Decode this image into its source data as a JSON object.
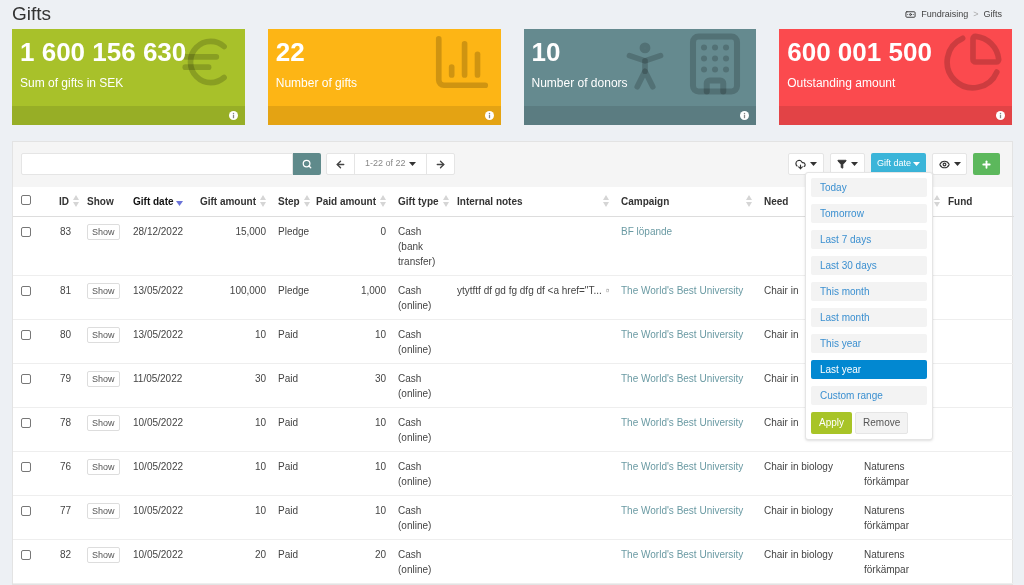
{
  "page_title": "Gifts",
  "breadcrumb": [
    "Fundraising",
    ">",
    "Gifts"
  ],
  "cards": [
    {
      "value": "1 600 156 630",
      "label": "Sum of gifts in SEK",
      "color": "#a8c12a"
    },
    {
      "value": "22",
      "label": "Number of gifts",
      "color": "#fdb515"
    },
    {
      "value": "10",
      "label": "Number of donors",
      "color": "#658a8f"
    },
    {
      "value": "600 001 500",
      "label": "Outstanding amount",
      "color": "#fb4a4e"
    }
  ],
  "toolbar": {
    "pagination": "1-22 of 22",
    "date_filter": "Gift date"
  },
  "table": {
    "select_all_checked": false,
    "columns": [
      {
        "label": "ID",
        "sorted": false
      },
      {
        "label": "Show",
        "sorted": false
      },
      {
        "label": "Gift date",
        "sorted": true
      },
      {
        "label": "Gift amount",
        "sorted": false
      },
      {
        "label": "Step",
        "sorted": false
      },
      {
        "label": "Paid amount",
        "sorted": false
      },
      {
        "label": "Gift type",
        "sorted": false
      },
      {
        "label": "Internal notes",
        "sorted": false
      },
      {
        "label": "Campaign",
        "sorted": false
      },
      {
        "label": "Need",
        "sorted": false
      },
      {
        "sorted": false
      },
      {
        "label": "Fund",
        "sorted": false
      }
    ],
    "rows": [
      {
        "checked": false,
        "id": "83",
        "show": "Show",
        "gift_date": "28/12/2022",
        "gift_amount": "15,000",
        "step": "Pledge",
        "paid_amount": "0",
        "gift_type": "Cash (bank transfer)",
        "campaign": "BF löpande"
      },
      {
        "checked": false,
        "id": "81",
        "show": "Show",
        "gift_date": "13/05/2022",
        "gift_amount": "100,000",
        "step": "Pledge",
        "paid_amount": "1,000",
        "gift_type": "Cash (online)",
        "internal_notes": "ytytftf df gd fg dfg df <a href=\"T...",
        "campaign": "The World's Best University",
        "need": "Chair in"
      },
      {
        "checked": false,
        "id": "80",
        "show": "Show",
        "gift_date": "13/05/2022",
        "gift_amount": "10",
        "step": "Paid",
        "paid_amount": "10",
        "gift_type": "Cash (online)",
        "campaign": "The World's Best University",
        "need": "Chair in"
      },
      {
        "checked": false,
        "id": "79",
        "show": "Show",
        "gift_date": "11/05/2022",
        "gift_amount": "30",
        "step": "Paid",
        "paid_amount": "30",
        "gift_type": "Cash (online)",
        "campaign": "The World's Best University",
        "need": "Chair in"
      },
      {
        "checked": false,
        "id": "78",
        "show": "Show",
        "gift_date": "10/05/2022",
        "gift_amount": "10",
        "step": "Paid",
        "paid_amount": "10",
        "gift_type": "Cash (online)",
        "campaign": "The World's Best University",
        "need": "Chair in"
      },
      {
        "checked": false,
        "id": "76",
        "show": "Show",
        "gift_date": "10/05/2022",
        "gift_amount": "10",
        "step": "Paid",
        "paid_amount": "10",
        "gift_type": "Cash (online)",
        "campaign": "The World's Best University",
        "need": "Chair in biology",
        "column_11": "Naturens förkämpar"
      },
      {
        "checked": false,
        "id": "77",
        "show": "Show",
        "gift_date": "10/05/2022",
        "gift_amount": "10",
        "step": "Paid",
        "paid_amount": "10",
        "gift_type": "Cash (online)",
        "campaign": "The World's Best University",
        "need": "Chair in biology",
        "column_11": "Naturens förkämpar"
      },
      {
        "checked": false,
        "id": "82",
        "show": "Show",
        "gift_date": "10/05/2022",
        "gift_amount": "20",
        "step": "Paid",
        "paid_amount": "20",
        "gift_type": "Cash (online)",
        "campaign": "The World's Best University",
        "need": "Chair in biology",
        "column_11": "Naturens förkämpar"
      }
    ]
  },
  "date_menu": {
    "options": [
      {
        "label": "Today",
        "selected": false
      },
      {
        "label": "Tomorrow",
        "selected": false
      },
      {
        "label": "Last 7 days",
        "selected": false
      },
      {
        "label": "Last 30 days",
        "selected": false
      },
      {
        "label": "This month",
        "selected": false
      },
      {
        "label": "Last month",
        "selected": false
      },
      {
        "label": "This year",
        "selected": false
      },
      {
        "label": "Last year",
        "selected": true
      },
      {
        "label": "Custom range",
        "selected": false
      }
    ],
    "buttons": [
      "Apply",
      "Remove"
    ]
  }
}
